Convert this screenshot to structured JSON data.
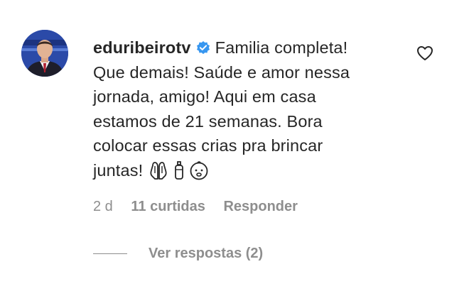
{
  "comment": {
    "username": "eduribeirotv",
    "verified_icon": "verified-badge-icon",
    "text_lines": [
      "Familia completa!",
      "Que demais! Saúde e amor nessa",
      "jornada, amigo! Aqui em casa",
      "estamos de 21 semanas. Bora",
      "colocar essas crias pra brincar",
      "juntas!"
    ],
    "emoji_icons": [
      "praying-hands-icon",
      "baby-bottle-icon",
      "baby-face-icon"
    ],
    "like_icon": "heart-outline-icon"
  },
  "meta": {
    "time": "2 d",
    "likes": "11 curtidas",
    "reply_label": "Responder"
  },
  "replies": {
    "label": "Ver respostas (2)"
  },
  "colors": {
    "text": "#262626",
    "secondary": "#8e8e8e",
    "verified": "#3897f0"
  }
}
